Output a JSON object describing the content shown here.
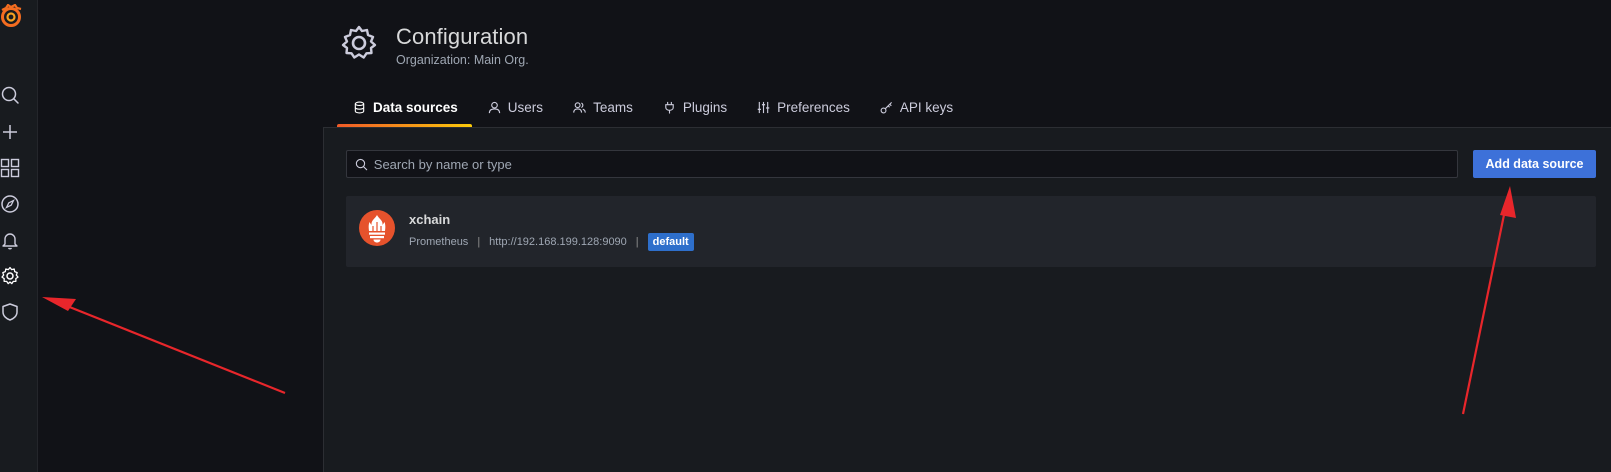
{
  "sidebar": {
    "items": [
      {
        "icon": "search-icon"
      },
      {
        "icon": "plus-icon"
      },
      {
        "icon": "dashboards-icon"
      },
      {
        "icon": "explore-compass-icon"
      },
      {
        "icon": "alerting-bell-icon"
      },
      {
        "icon": "gear-icon"
      },
      {
        "icon": "shield-icon"
      }
    ]
  },
  "header": {
    "title": "Configuration",
    "subtitle": "Organization: Main Org."
  },
  "tabs": [
    {
      "label": "Data sources",
      "icon": "database-icon",
      "active": true
    },
    {
      "label": "Users",
      "icon": "user-icon",
      "active": false
    },
    {
      "label": "Teams",
      "icon": "users-icon",
      "active": false
    },
    {
      "label": "Plugins",
      "icon": "plug-icon",
      "active": false
    },
    {
      "label": "Preferences",
      "icon": "sliders-icon",
      "active": false
    },
    {
      "label": "API keys",
      "icon": "key-icon",
      "active": false
    }
  ],
  "search": {
    "placeholder": "Search by name or type"
  },
  "add_button": {
    "label": "Add data source"
  },
  "datasources": [
    {
      "name": "xchain",
      "type": "Prometheus",
      "url": "http://192.168.199.128:9090",
      "badge": "default"
    }
  ],
  "colors": {
    "accent_blue": "#3d71d9",
    "tab_underline_start": "#f05a28",
    "tab_underline_end": "#fbca0a",
    "annotation_arrow": "#e8262b",
    "prometheus_logo": "#e6522c"
  }
}
